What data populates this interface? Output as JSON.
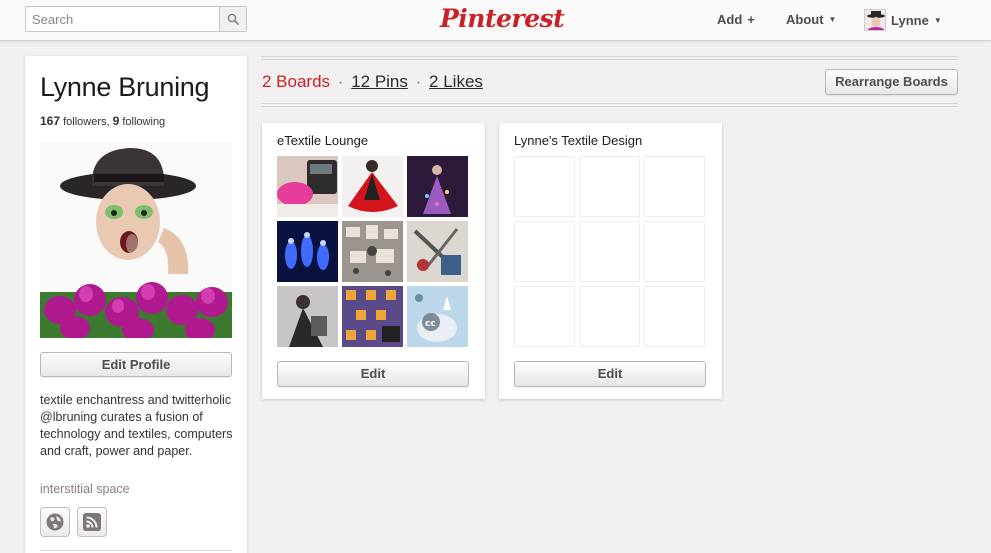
{
  "header": {
    "search_placeholder": "Search",
    "logo": "Pinterest",
    "add_label": "Add",
    "add_symbol": "+",
    "about_label": "About",
    "user_label": "Lynne",
    "caret": "▼"
  },
  "profile": {
    "name": "Lynne Bruning",
    "followers_count": "167",
    "followers_label": "followers,",
    "following_count": "9",
    "following_label": "following",
    "edit_profile_label": "Edit Profile",
    "bio": "textile enchantress and twitterholic @lbruning curates a fusion of technology and textiles, computers and craft, power and paper.",
    "website": "interstitial space"
  },
  "main": {
    "boards_count_label": "2 Boards",
    "separator": "·",
    "pins_count_label": "12 Pins",
    "likes_count_label": "2 Likes",
    "rearrange_label": "Rearrange Boards"
  },
  "boards": [
    {
      "title": "eTextile Lounge",
      "edit_label": "Edit"
    },
    {
      "title": "Lynne's Textile Design",
      "edit_label": "Edit"
    }
  ],
  "colors": {
    "brand_red": "#cb2027",
    "background": "#f2f0f0",
    "text_dark": "#211922"
  },
  "icons": {
    "search": "search-icon",
    "globe": "globe-icon",
    "rss": "rss-icon"
  }
}
